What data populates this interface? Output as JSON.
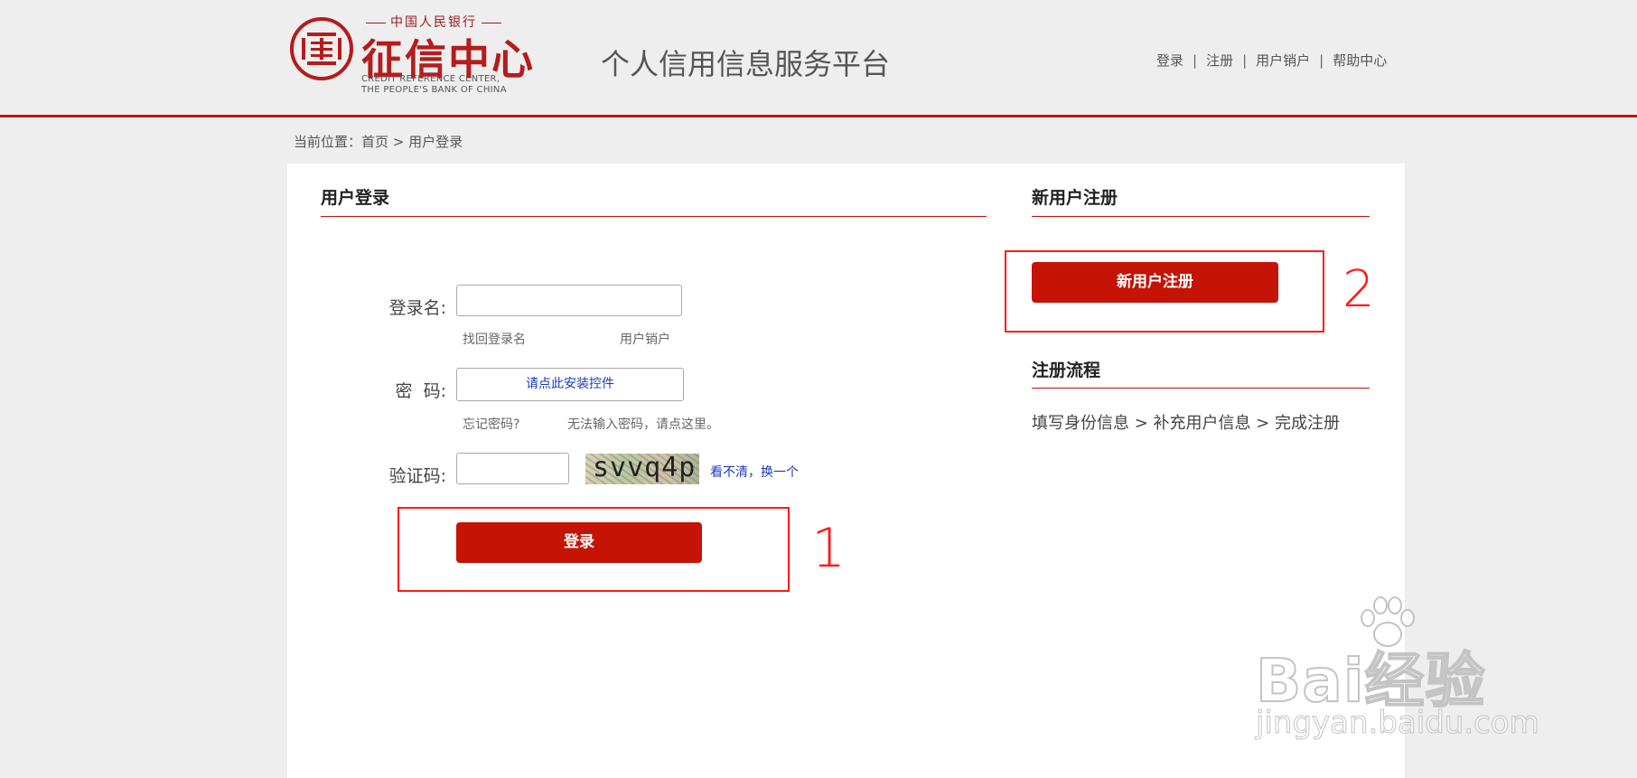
{
  "header": {
    "logo": {
      "cn_top": "中国人民银行",
      "main": "征信中心",
      "en_line1": "CREDIT REFERENCE  CENTER,",
      "en_line2": "THE PEOPLE'S BANK OF CHINA",
      "icon": "seal-logo-icon"
    },
    "platform_title": "个人信用信息服务平台",
    "nav": [
      {
        "label": "登录"
      },
      {
        "label": "注册"
      },
      {
        "label": "用户销户"
      },
      {
        "label": "帮助中心"
      }
    ],
    "nav_separator": "|"
  },
  "breadcrumb": {
    "prefix": "当前位置：",
    "home": "首页",
    "sep": " > ",
    "current": "用户登录"
  },
  "login": {
    "title": "用户登录",
    "username_label": "登录名:",
    "username_value": "",
    "find_username": "找回登录名",
    "cancel_account": "用户销户",
    "password_label": "密  码:",
    "plugin_button": "请点此安装控件",
    "forgot_password": "忘记密码?",
    "cannot_input": "无法输入密码，请点这里。",
    "captcha_label": "验证码:",
    "captcha_value": "",
    "captcha_text": "svvq4p",
    "refresh_captcha": "看不清，换一个",
    "submit_button": "登录"
  },
  "register": {
    "title": "新用户注册",
    "button": "新用户注册",
    "flow_title": "注册流程",
    "flow_text": "填写身份信息 > 补充用户信息 > 完成注册"
  },
  "annotations": {
    "box1_number": "1",
    "box2_number": "2",
    "color": "#ff1a1a"
  },
  "watermark": {
    "main": "Bai经验",
    "sub": "jingyan.baidu.com"
  },
  "colors": {
    "accent_red": "#c51305",
    "header_line": "#c01010",
    "link_blue": "#1a3bbf"
  }
}
